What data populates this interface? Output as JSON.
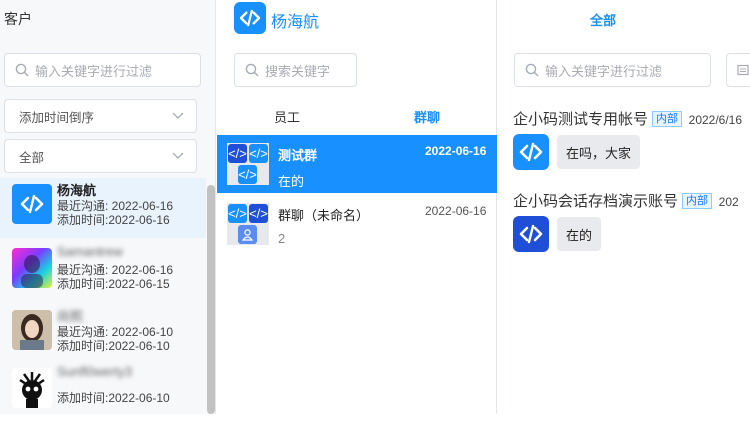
{
  "customers_panel": {
    "title": "客户",
    "filter_placeholder": "输入关键字进行过滤",
    "sort_select": "添加时间倒序",
    "range_select": "全部",
    "items": [
      {
        "name": "杨海航",
        "last_contact": "最近沟通: 2022-06-16",
        "added": "添加时间:2022-06-16",
        "avatar": "code-logo"
      },
      {
        "name": "Samantrew",
        "last_contact": "最近沟通: 2022-06-16",
        "added": "添加时间:2022-06-15",
        "avatar": "colorful-photo"
      },
      {
        "name": "尚熙",
        "last_contact": "最近沟通: 2022-06-10",
        "added": "添加时间:2022-06-10",
        "avatar": "portrait-photo"
      },
      {
        "name": "Sunfl0werty3",
        "last_contact": "",
        "added": "添加时间:2022-06-10",
        "avatar": "cartoon-photo"
      }
    ]
  },
  "staff_panel": {
    "name": "杨海航",
    "search_placeholder": "搜索关键字",
    "tabs": [
      "员工",
      "群聊"
    ],
    "active_tab": "群聊",
    "groups": [
      {
        "name": "测试群",
        "sub": "在的",
        "date": "2022-06-16",
        "selected": true
      },
      {
        "name": "群聊（未命名）",
        "sub": "2",
        "date": "2022-06-16",
        "selected": false
      }
    ]
  },
  "chat_panel": {
    "tab": "全部",
    "filter_placeholder": "输入关键字进行过滤",
    "messages": [
      {
        "sender": "企小码测试专用帐号",
        "tag": "内部",
        "time": "2022/6/16",
        "text": "在吗，大家"
      },
      {
        "sender": "企小码会话存档演示账号",
        "tag": "内部",
        "time": "202",
        "text": "在的"
      }
    ]
  },
  "colors": {
    "accent": "#1890ff",
    "selected_row": "#1890ff",
    "bubble": "#e9eaed"
  },
  "icons": [
    "search-icon",
    "chevron-down-icon",
    "code-logo-icon",
    "document-icon",
    "user-icon"
  ]
}
